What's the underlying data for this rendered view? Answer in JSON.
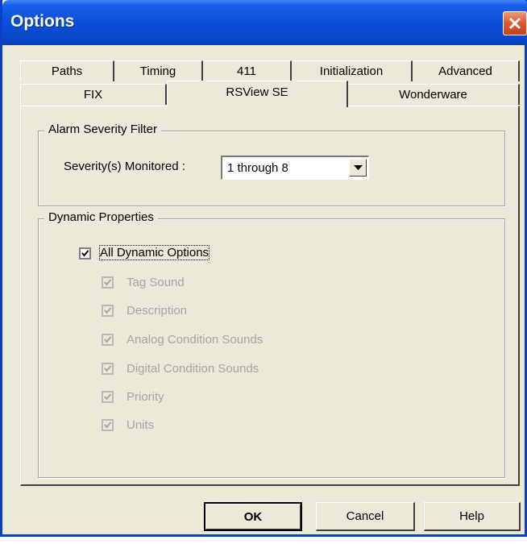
{
  "window": {
    "title": "Options"
  },
  "tabs": {
    "row1": [
      "Paths",
      "Timing",
      "411",
      "Initialization",
      "Advanced"
    ],
    "row2": [
      "FIX",
      "RSView SE",
      "Wonderware"
    ],
    "active": "RSView SE"
  },
  "alarm_filter": {
    "legend": "Alarm Severity Filter",
    "label": "Severity(s)  Monitored :",
    "selected": "1 through 8"
  },
  "dynamic": {
    "legend": "Dynamic Properties",
    "all_label": "All Dynamic Options",
    "all_checked": true,
    "items": [
      {
        "label": "Tag Sound",
        "checked": true
      },
      {
        "label": "Description",
        "checked": true
      },
      {
        "label": "Analog Condition Sounds",
        "checked": true
      },
      {
        "label": "Digital Condition Sounds",
        "checked": true
      },
      {
        "label": "Priority",
        "checked": true
      },
      {
        "label": "Units",
        "checked": true
      }
    ]
  },
  "buttons": {
    "ok": "OK",
    "cancel": "Cancel",
    "help": "Help"
  },
  "colors": {
    "titlebar": "#0b4fd8",
    "face": "#ece9d8",
    "close": "#e05a34"
  }
}
